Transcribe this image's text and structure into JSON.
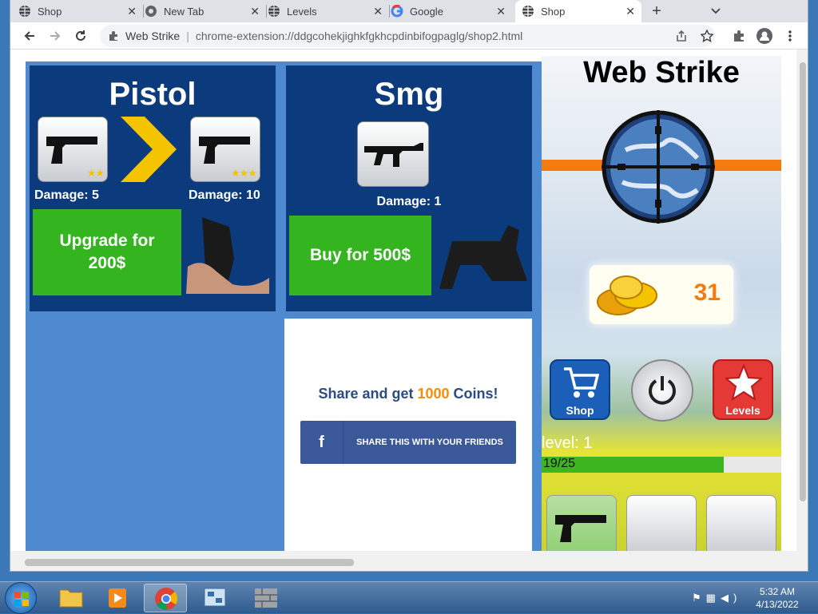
{
  "browser": {
    "tabs": [
      {
        "title": "Shop",
        "icon": "globe-icon",
        "active": false
      },
      {
        "title": "New Tab",
        "icon": "chrome-icon",
        "active": false
      },
      {
        "title": "Levels",
        "icon": "globe-icon",
        "active": false
      },
      {
        "title": "Google",
        "icon": "google-icon",
        "active": false
      },
      {
        "title": "Shop",
        "icon": "globe-icon",
        "active": true
      }
    ],
    "site_name": "Web Strike",
    "url": "chrome-extension://ddgcohekjighkfgkhcpdinbifogpaglg/shop2.html"
  },
  "shop": {
    "pistol": {
      "title": "Pistol",
      "current_stars": "★★",
      "next_stars": "★★★",
      "damage_current": "Damage: 5",
      "damage_next": "Damage: 10",
      "button_label": "Upgrade for 200$"
    },
    "smg": {
      "title": "Smg",
      "damage": "Damage: 1",
      "button_label": "Buy for 500$"
    },
    "share": {
      "text_before": "Share and get ",
      "amount": "1000",
      "text_after": " Coins!",
      "button_icon": "f",
      "button_label": "SHARE THIS WITH YOUR FRIENDS"
    }
  },
  "panel": {
    "title": "Web Strike",
    "coins": "31",
    "shop_label": "Shop",
    "levels_label": "Levels",
    "level_text": "level: 1",
    "xp_text": "19/25",
    "xp_fraction": 0.76
  },
  "taskbar": {
    "time": "5:32 AM",
    "date": "4/13/2022"
  },
  "colors": {
    "card_bg": "#0b3a7d",
    "buy_button": "#34b520",
    "accent_orange": "#f47b10",
    "share_blue": "#3b5998"
  }
}
